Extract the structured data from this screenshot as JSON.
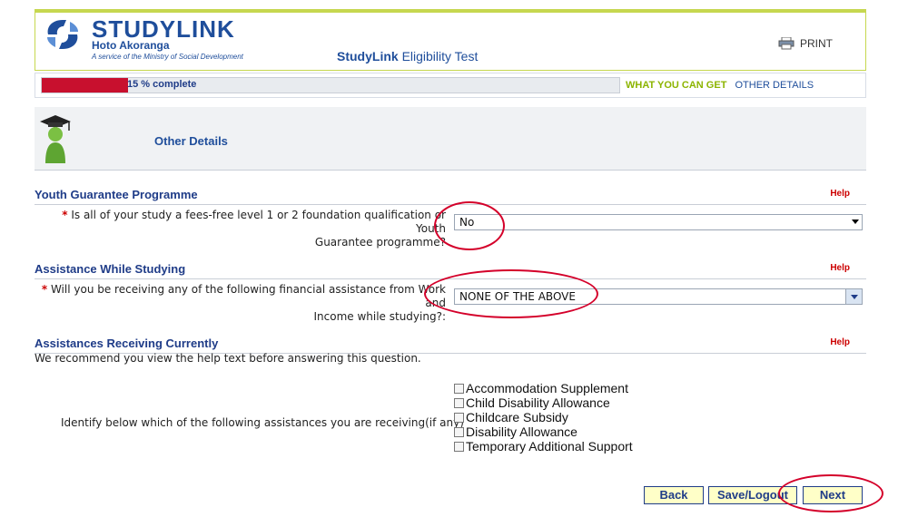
{
  "header": {
    "logo_name": "STUDYLINK",
    "logo_sub": "Hoto Akoranga",
    "logo_tagline": "A service of the Ministry of Social Development",
    "title_bold": "StudyLink",
    "title_rest": "Eligibility Test",
    "print_label": "PRINT"
  },
  "progress": {
    "percent_value": 15,
    "label": "15 % complete",
    "steps": [
      "WHAT YOU CAN GET",
      "OTHER DETAILS"
    ]
  },
  "section": {
    "title": "Other Details"
  },
  "questions": [
    {
      "heading": "Youth Guarantee Programme",
      "help": "Help",
      "required_mark": "*",
      "label_line1": "Is all of your study a fees-free level 1 or 2 foundation qualification or Youth",
      "label_line2": "Guarantee programme?",
      "selected": "No"
    },
    {
      "heading": "Assistance While Studying",
      "help": "Help",
      "required_mark": "*",
      "label_line1": "Will you be receiving any of the following financial assistance from Work and",
      "label_line2": "Income while studying?:",
      "selected": "NONE OF THE ABOVE"
    }
  ],
  "assistances": {
    "heading": "Assistances Receiving Currently",
    "help": "Help",
    "note": "We recommend you view the help text before answering this question.",
    "identify_label": "Identify below which of the following assistances you are receiving(if any)",
    "options": [
      "Accommodation Supplement",
      "Child Disability Allowance",
      "Childcare Subsidy",
      "Disability Allowance",
      "Temporary Additional Support"
    ]
  },
  "buttons": {
    "back": "Back",
    "save": "Save/Logout",
    "next": "Next"
  },
  "colors": {
    "brand": "#1f4e9b",
    "accent": "#c6d74f",
    "progress": "#c8102e",
    "annotation": "#d4002a"
  }
}
